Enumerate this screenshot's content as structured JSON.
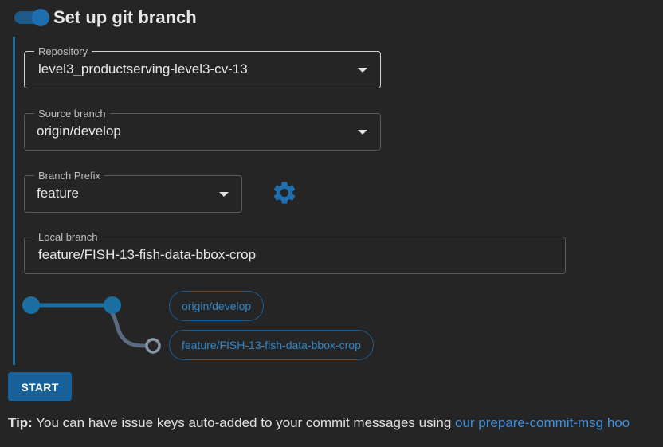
{
  "header": {
    "title": "Set up git branch",
    "toggle_on": true
  },
  "form": {
    "repository": {
      "label": "Repository",
      "value": "level3_productserving-level3-cv-13"
    },
    "source_branch": {
      "label": "Source branch",
      "value": "origin/develop"
    },
    "branch_prefix": {
      "label": "Branch Prefix",
      "value": "feature"
    },
    "local_branch": {
      "label": "Local branch",
      "value": "feature/FISH-13-fish-data-bbox-crop"
    }
  },
  "graph": {
    "source_pill": "origin/develop",
    "target_pill": "feature/FISH-13-fish-data-bbox-crop"
  },
  "actions": {
    "start_label": "START"
  },
  "tip": {
    "label": "Tip:",
    "text": " You can have issue keys auto-added to your commit messages using ",
    "link": "our prepare-commit-msg hoo"
  },
  "colors": {
    "accent": "#1b6fa0",
    "button": "#16619b",
    "link": "#3b8fe0",
    "background": "#252526"
  },
  "icons": [
    "toggle-switch",
    "chevron-down-icon",
    "gear-icon"
  ]
}
